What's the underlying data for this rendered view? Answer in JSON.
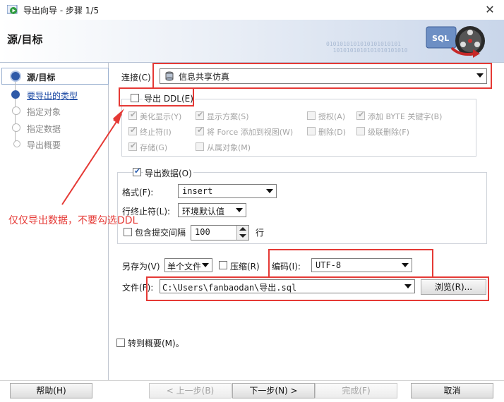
{
  "window": {
    "title": "导出向导 - 步骤 1/5",
    "close": "✕"
  },
  "header": {
    "title": "源/目标",
    "binary": "0101010101010101010101\n  1010101010101010101010",
    "graphic_label": "SQL"
  },
  "steps": [
    {
      "label": "源/目标",
      "state": "current"
    },
    {
      "label": "要导出的类型",
      "state": "link"
    },
    {
      "label": "指定对象",
      "state": "disabled"
    },
    {
      "label": "指定数据",
      "state": "disabled"
    },
    {
      "label": "导出概要",
      "state": "disabled"
    }
  ],
  "connection": {
    "label": "连接(C)",
    "value": "信息共享仿真"
  },
  "ddl": {
    "label": "导出 DDL(E)",
    "checked": false,
    "options": [
      {
        "label": "美化显示(Y)",
        "checked": true
      },
      {
        "label": "显示方案(S)",
        "checked": true
      },
      {
        "label": "授权(A)",
        "checked": false
      },
      {
        "label": "添加 BYTE 关键字(B)",
        "checked": true
      },
      {
        "label": "终止符(I)",
        "checked": true
      },
      {
        "label": "将 Force 添加到视图(W)",
        "checked": true
      },
      {
        "label": "删除(D)",
        "checked": false
      },
      {
        "label": "级联删除(F)",
        "checked": false
      },
      {
        "label": "存储(G)",
        "checked": true
      },
      {
        "label": "从属对象(M)",
        "checked": false
      }
    ]
  },
  "data_export": {
    "label": "导出数据(O)",
    "checked": true,
    "format_label": "格式(F):",
    "format_value": "insert",
    "terminator_label": "行终止符(L):",
    "terminator_value": "环境默认值",
    "commit_label": "包含提交间隔",
    "commit_value": "100",
    "commit_unit": "行"
  },
  "save_as": {
    "label": "另存为(V)",
    "value": "单个文件",
    "compress_label": "压缩(R)"
  },
  "encoding": {
    "label": "编码(I):",
    "value": "UTF-8"
  },
  "file": {
    "label": "文件(F):",
    "value": "C:\\Users\\fanbaodan\\导出.sql",
    "browse": "浏览(R)..."
  },
  "summary_checkbox": "转到概要(M)。",
  "annotation": "仅仅导出数据，不要勾选DDL",
  "buttons": {
    "help": "帮助(H)",
    "back": "< 上一步(B)",
    "next": "下一步(N) >",
    "finish": "完成(F)",
    "cancel": "取消"
  },
  "colors": {
    "annotation": "#e53935",
    "link": "#1b49a3",
    "header_gradient_end": "#c9d6ea"
  }
}
